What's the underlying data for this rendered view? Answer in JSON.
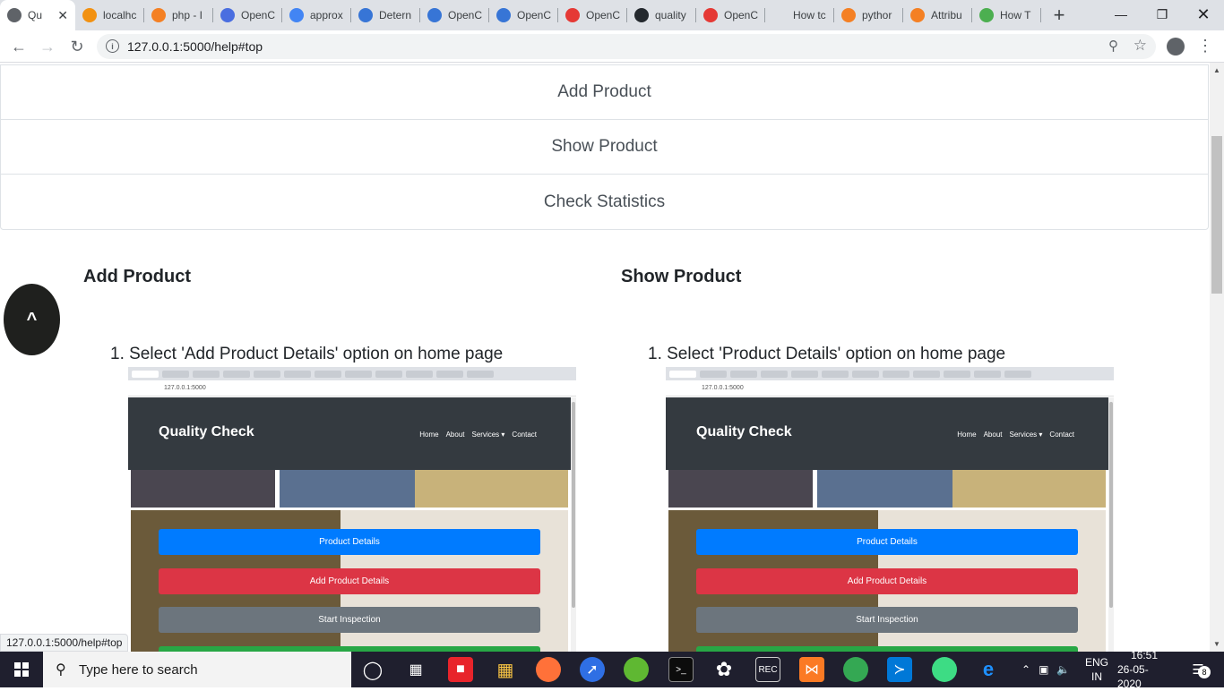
{
  "browser": {
    "tabs": [
      {
        "title": "Qu",
        "color": "#5f6368",
        "active": true
      },
      {
        "title": "localhc",
        "color": "#f29111"
      },
      {
        "title": "php - I",
        "color": "#f48024"
      },
      {
        "title": "OpenC",
        "color": "#4a6ee0"
      },
      {
        "title": "approx",
        "color": "#4285f4"
      },
      {
        "title": "Detern",
        "color": "#3775d6"
      },
      {
        "title": "OpenC",
        "color": "#3775d6"
      },
      {
        "title": "OpenC",
        "color": "#3775d6"
      },
      {
        "title": "OpenC",
        "color": "#e53935"
      },
      {
        "title": "quality",
        "color": "#24292e"
      },
      {
        "title": "OpenC",
        "color": "#e53935"
      },
      {
        "title": "How tc",
        "color": "#dee1e6"
      },
      {
        "title": "pythor",
        "color": "#f48024"
      },
      {
        "title": "Attribu",
        "color": "#f48024"
      },
      {
        "title": "How T",
        "color": "#4caf50"
      }
    ],
    "url": "127.0.0.1:5000/help#top",
    "status_url": "127.0.0.1:5000/help#top"
  },
  "page": {
    "list_items": [
      "Add Product",
      "Show Product",
      "Check Statistics"
    ],
    "back_to_top": "^",
    "left": {
      "title": "Add Product",
      "step": "1. Select 'Add Product Details' option on home page"
    },
    "right": {
      "title": "Show Product",
      "step": "1. Select 'Product Details' option on home page"
    },
    "screenshot": {
      "address": "127.0.0.1:5000",
      "brand": "Quality Check",
      "nav": [
        "Home",
        "About",
        "Services ▾",
        "Contact"
      ],
      "buttons": [
        {
          "label": "Product Details",
          "color": "#007bff"
        },
        {
          "label": "Add Product Details",
          "color": "#dc3545"
        },
        {
          "label": "Start Inspection",
          "color": "#6c757d"
        },
        {
          "label": "",
          "color": "#28a745"
        }
      ]
    }
  },
  "taskbar": {
    "search_placeholder": "Type here to search",
    "lang_top": "ENG",
    "lang_bottom": "IN",
    "time": "16:51",
    "date": "26-05-2020",
    "notifications": "8"
  }
}
